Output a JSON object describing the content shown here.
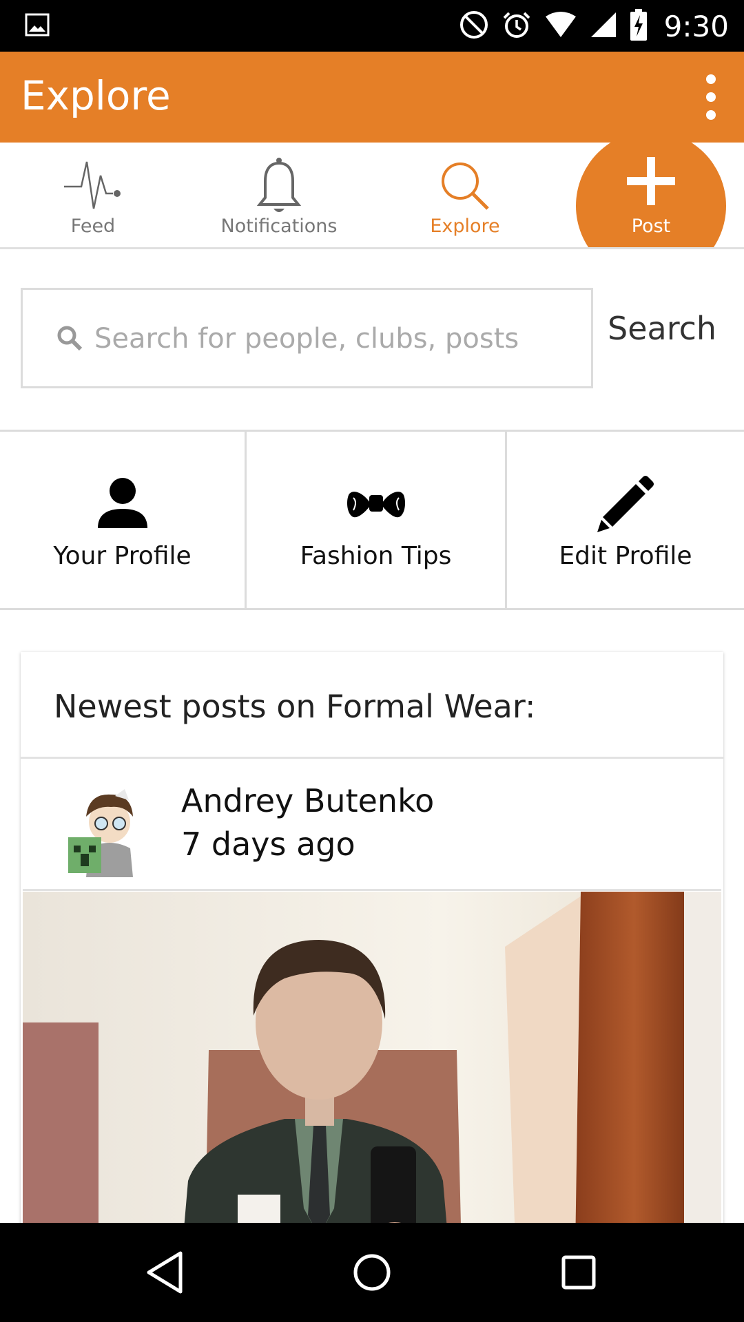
{
  "status_bar": {
    "time": "9:30",
    "icons": [
      "image-icon",
      "do-not-disturb-icon",
      "alarm-icon",
      "wifi-icon",
      "signal-icon",
      "battery-charging-icon"
    ]
  },
  "app_bar": {
    "title": "Explore",
    "menu_icon": "overflow-menu-icon"
  },
  "tabs": [
    {
      "label": "Feed",
      "icon": "pulse-icon",
      "active": false
    },
    {
      "label": "Notifications",
      "icon": "bell-icon",
      "active": false
    },
    {
      "label": "Explore",
      "icon": "search-icon",
      "active": true
    },
    {
      "label": "Post",
      "icon": "plus-icon",
      "active": false
    }
  ],
  "search": {
    "placeholder": "Search for people, clubs, posts",
    "value": "",
    "button_label": "Search"
  },
  "actions": [
    {
      "label": "Your Profile",
      "icon": "person-icon"
    },
    {
      "label": "Fashion Tips",
      "icon": "bow-tie-icon"
    },
    {
      "label": "Edit Profile",
      "icon": "pencil-icon"
    }
  ],
  "card": {
    "title": "Newest posts on Formal Wear:",
    "post": {
      "author": "Andrey Butenko",
      "time": "7 days ago"
    }
  },
  "nav": [
    "back-icon",
    "home-icon",
    "recents-icon"
  ],
  "colors": {
    "accent": "#E57F27",
    "status_bar": "#000000",
    "divider": "#dcdcdc"
  }
}
